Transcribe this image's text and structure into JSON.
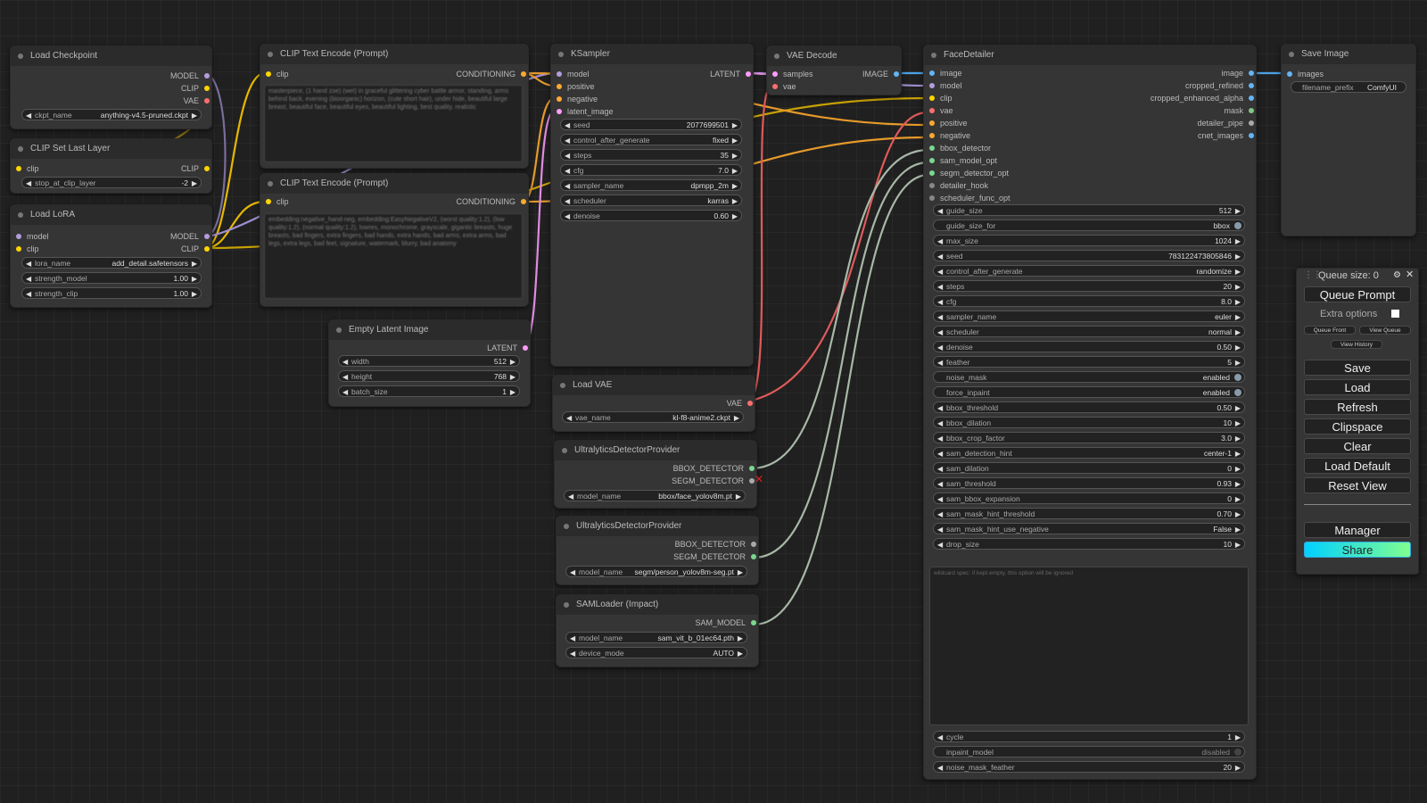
{
  "nodes": {
    "load_checkpoint": {
      "title": "Load Checkpoint",
      "outputs": [
        "MODEL",
        "CLIP",
        "VAE"
      ],
      "ckpt_label": "ckpt_name",
      "ckpt_value": "anything-v4.5-pruned.ckpt"
    },
    "clip_set_last_layer": {
      "title": "CLIP Set Last Layer",
      "input": "clip",
      "output": "CLIP",
      "w_label": "stop_at_clip_layer",
      "w_value": "-2"
    },
    "load_lora": {
      "title": "Load LoRA",
      "inputs": [
        "model",
        "clip"
      ],
      "outputs": [
        "MODEL",
        "CLIP"
      ],
      "widgets": [
        {
          "label": "lora_name",
          "value": "add_detail.safetensors"
        },
        {
          "label": "strength_model",
          "value": "1.00"
        },
        {
          "label": "strength_clip",
          "value": "1.00"
        }
      ]
    },
    "clip_text_pos": {
      "title": "CLIP Text Encode (Prompt)",
      "input": "clip",
      "output": "CONDITIONING",
      "text": "masterpiece, (1 hand zoe) (wet) in graceful glittering cyber battle armor, standing, arms behind back, evening (bioorganic) horizon, (cute short hair), under hide, beautiful large breast, beautiful face, beautiful eyes, beautiful lighting, best quality, realistic"
    },
    "clip_text_neg": {
      "title": "CLIP Text Encode (Prompt)",
      "input": "clip",
      "output": "CONDITIONING",
      "text": "embedding:negative_hand-neg, embedding:EasyNegativeV2, (worst quality:1.2), (low quality:1.2), (normal quality:1.2), lowres, monochrome, grayscale, gigantic breasts, huge breasts, bad fingers, extra fingers, bad hands, extra hands, bad arms, extra arms, bad legs, extra legs, bad feet, signature, watermark, blurry, bad anatomy"
    },
    "empty_latent": {
      "title": "Empty Latent Image",
      "output": "LATENT",
      "widgets": [
        {
          "label": "width",
          "value": "512"
        },
        {
          "label": "height",
          "value": "768"
        },
        {
          "label": "batch_size",
          "value": "1"
        }
      ]
    },
    "ksampler": {
      "title": "KSampler",
      "inputs": [
        "model",
        "positive",
        "negative",
        "latent_image"
      ],
      "output": "LATENT",
      "widgets": [
        {
          "label": "seed",
          "value": "2077699501"
        },
        {
          "label": "control_after_generate",
          "value": "fixed"
        },
        {
          "label": "steps",
          "value": "35"
        },
        {
          "label": "cfg",
          "value": "7.0"
        },
        {
          "label": "sampler_name",
          "value": "dpmpp_2m"
        },
        {
          "label": "scheduler",
          "value": "karras"
        },
        {
          "label": "denoise",
          "value": "0.60"
        }
      ]
    },
    "load_vae": {
      "title": "Load VAE",
      "output": "VAE",
      "w_label": "vae_name",
      "w_value": "kl-f8-anime2.ckpt"
    },
    "ultra1": {
      "title": "UltralyticsDetectorProvider",
      "outputs": [
        "BBOX_DETECTOR",
        "SEGM_DETECTOR"
      ],
      "w_label": "model_name",
      "w_value": "bbox/face_yolov8m.pt"
    },
    "ultra2": {
      "title": "UltralyticsDetectorProvider",
      "outputs": [
        "BBOX_DETECTOR",
        "SEGM_DETECTOR"
      ],
      "w_label": "model_name",
      "w_value": "segm/person_yolov8m-seg.pt"
    },
    "samloader": {
      "title": "SAMLoader (Impact)",
      "output": "SAM_MODEL",
      "widgets": [
        {
          "label": "model_name",
          "value": "sam_vit_b_01ec64.pth"
        },
        {
          "label": "device_mode",
          "value": "AUTO"
        }
      ]
    },
    "vae_decode": {
      "title": "VAE Decode",
      "inputs": [
        "samples",
        "vae"
      ],
      "output": "IMAGE"
    },
    "face_detailer": {
      "title": "FaceDetailer",
      "inputs": [
        "image",
        "model",
        "clip",
        "vae",
        "positive",
        "negative",
        "bbox_detector",
        "sam_model_opt",
        "segm_detector_opt",
        "detailer_hook",
        "scheduler_func_opt"
      ],
      "outputs": [
        "image",
        "cropped_refined",
        "cropped_enhanced_alpha",
        "mask",
        "detailer_pipe",
        "cnet_images"
      ],
      "widgets": [
        {
          "label": "guide_size",
          "value": "512",
          "kind": "num"
        },
        {
          "label": "guide_size_for",
          "value": "bbox",
          "kind": "toggle"
        },
        {
          "label": "max_size",
          "value": "1024",
          "kind": "num"
        },
        {
          "label": "seed",
          "value": "783122473805846",
          "kind": "num"
        },
        {
          "label": "control_after_generate",
          "value": "randomize",
          "kind": "num"
        },
        {
          "label": "steps",
          "value": "20",
          "kind": "num"
        },
        {
          "label": "cfg",
          "value": "8.0",
          "kind": "num"
        },
        {
          "label": "sampler_name",
          "value": "euler",
          "kind": "num"
        },
        {
          "label": "scheduler",
          "value": "normal",
          "kind": "num"
        },
        {
          "label": "denoise",
          "value": "0.50",
          "kind": "num"
        },
        {
          "label": "feather",
          "value": "5",
          "kind": "num"
        },
        {
          "label": "noise_mask",
          "value": "enabled",
          "kind": "toggle"
        },
        {
          "label": "force_inpaint",
          "value": "enabled",
          "kind": "toggle"
        },
        {
          "label": "bbox_threshold",
          "value": "0.50",
          "kind": "num"
        },
        {
          "label": "bbox_dilation",
          "value": "10",
          "kind": "num"
        },
        {
          "label": "bbox_crop_factor",
          "value": "3.0",
          "kind": "num"
        },
        {
          "label": "sam_detection_hint",
          "value": "center-1",
          "kind": "num"
        },
        {
          "label": "sam_dilation",
          "value": "0",
          "kind": "num"
        },
        {
          "label": "sam_threshold",
          "value": "0.93",
          "kind": "num"
        },
        {
          "label": "sam_bbox_expansion",
          "value": "0",
          "kind": "num"
        },
        {
          "label": "sam_mask_hint_threshold",
          "value": "0.70",
          "kind": "num"
        },
        {
          "label": "sam_mask_hint_use_negative",
          "value": "False",
          "kind": "num"
        },
        {
          "label": "drop_size",
          "value": "10",
          "kind": "num"
        }
      ],
      "wildcard_placeholder": "wildcard spec: if kept empty, this option will be ignored",
      "bottom_widgets": [
        {
          "label": "cycle",
          "value": "1",
          "kind": "num"
        },
        {
          "label": "inpaint_model",
          "value": "disabled",
          "kind": "toggle-off"
        },
        {
          "label": "noise_mask_feather",
          "value": "20",
          "kind": "num"
        }
      ]
    },
    "save_image": {
      "title": "Save Image",
      "input": "images",
      "w_label": "filename_prefix",
      "w_value": "ComfyUI"
    }
  },
  "queue": {
    "size_label": "Queue size: 0",
    "queue_prompt": "Queue Prompt",
    "extra_options": "Extra options",
    "queue_front": "Queue Front",
    "view_queue": "View Queue",
    "view_history": "View History",
    "save": "Save",
    "load": "Load",
    "refresh": "Refresh",
    "clipspace": "Clipspace",
    "clear": "Clear",
    "load_default": "Load Default",
    "reset_view": "Reset View",
    "manager": "Manager",
    "share": "Share"
  },
  "colors": {
    "model": "#b39ddb",
    "clip": "#ffd500",
    "vae": "#ff6e6e",
    "conditioning": "#ffa931",
    "latent": "#ff9cf9",
    "image": "#64b5f6",
    "detector": "#7bd88f",
    "mask": "#81c784"
  }
}
